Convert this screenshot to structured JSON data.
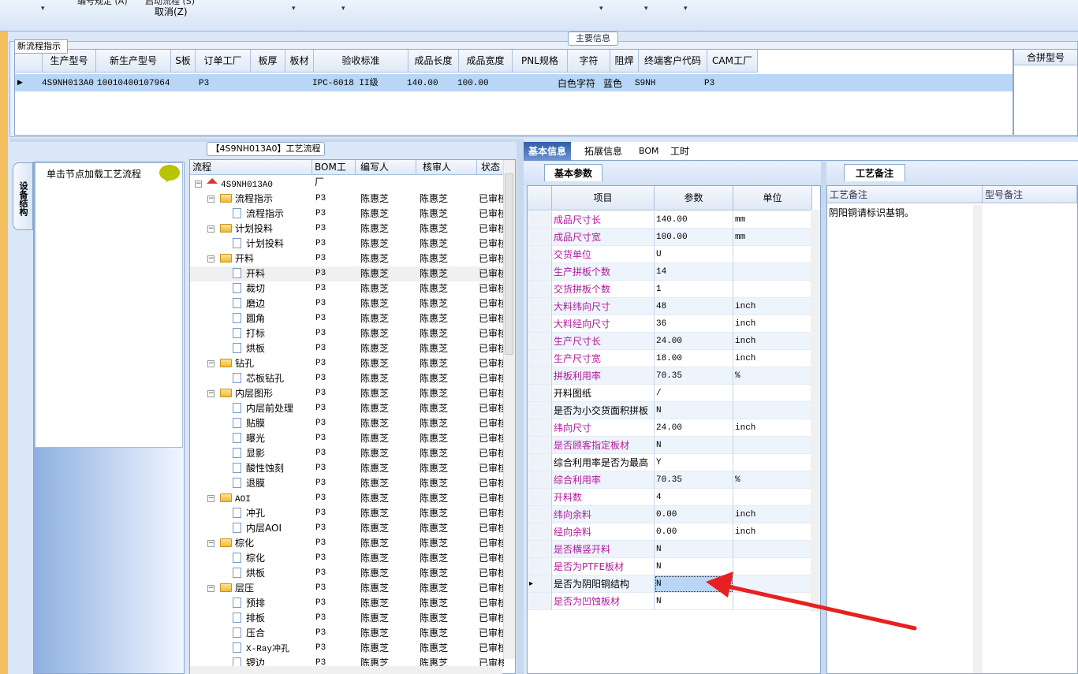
{
  "ribbon": {
    "cut_left": "编号规定 (A)",
    "cut_mid": "启动流程 (S)",
    "cancel": "取消(Z)",
    "dropdown_glyph": "▾"
  },
  "main": {
    "section_title": "主要信息",
    "flow_indicator_label": "新流程指示",
    "columns": [
      "生产型号",
      "新生产型号",
      "S板",
      "订单工厂",
      "板厚",
      "板材",
      "验收标准",
      "成品长度",
      "成品宽度",
      "PNL规格",
      "字符",
      "阻焊",
      "终端客户代码",
      "CAM工厂"
    ],
    "row": {
      "prod_model": "4S9NH013A0",
      "new_model": "10010400107964",
      "s_board": "",
      "order_factory": "P3",
      "thickness": "",
      "material": "",
      "standard": "IPC-6018 II级",
      "length": "140.00",
      "width": "100.00",
      "pnl": "",
      "char": "白色字符",
      "mask": "蓝色",
      "customer": "S9NH",
      "cam": "P3"
    },
    "merge_title": "合拼型号"
  },
  "process": {
    "title": "【4S9NH013A0】工艺流程",
    "vtab": "设备结构",
    "load_hint": "单击节点加载工艺流程",
    "columns": [
      "流程",
      "BOM工厂",
      "编写人",
      "核审人",
      "状态"
    ],
    "root": "4S9NH013A0",
    "nodes": [
      {
        "name": "流程指示",
        "type": "folder",
        "f": "P3",
        "w": "陈惠芝",
        "r": "陈惠芝",
        "s": "已审核"
      },
      {
        "name": "流程指示",
        "type": "doc",
        "f": "P3",
        "w": "陈惠芝",
        "r": "陈惠芝",
        "s": "已审核"
      },
      {
        "name": "计划投料",
        "type": "folder",
        "f": "P3",
        "w": "陈惠芝",
        "r": "陈惠芝",
        "s": "已审核"
      },
      {
        "name": "计划投料",
        "type": "doc",
        "f": "P3",
        "w": "陈惠芝",
        "r": "陈惠芝",
        "s": "已审核"
      },
      {
        "name": "开料",
        "type": "folder",
        "f": "P3",
        "w": "陈惠芝",
        "r": "陈惠芝",
        "s": "已审核"
      },
      {
        "name": "开料",
        "type": "doc",
        "f": "P3",
        "w": "陈惠芝",
        "r": "陈惠芝",
        "s": "已审核"
      },
      {
        "name": "裁切",
        "type": "doc",
        "f": "P3",
        "w": "陈惠芝",
        "r": "陈惠芝",
        "s": "已审核"
      },
      {
        "name": "磨边",
        "type": "doc",
        "f": "P3",
        "w": "陈惠芝",
        "r": "陈惠芝",
        "s": "已审核"
      },
      {
        "name": "圆角",
        "type": "doc",
        "f": "P3",
        "w": "陈惠芝",
        "r": "陈惠芝",
        "s": "已审核"
      },
      {
        "name": "打标",
        "type": "doc",
        "f": "P3",
        "w": "陈惠芝",
        "r": "陈惠芝",
        "s": "已审核"
      },
      {
        "name": "烘板",
        "type": "doc",
        "f": "P3",
        "w": "陈惠芝",
        "r": "陈惠芝",
        "s": "已审核"
      },
      {
        "name": "钻孔",
        "type": "folder",
        "f": "P3",
        "w": "陈惠芝",
        "r": "陈惠芝",
        "s": "已审核"
      },
      {
        "name": "芯板钻孔",
        "type": "doc",
        "f": "P3",
        "w": "陈惠芝",
        "r": "陈惠芝",
        "s": "已审核"
      },
      {
        "name": "内层图形",
        "type": "folder",
        "f": "P3",
        "w": "陈惠芝",
        "r": "陈惠芝",
        "s": "已审核"
      },
      {
        "name": "内层前处理",
        "type": "doc",
        "f": "P3",
        "w": "陈惠芝",
        "r": "陈惠芝",
        "s": "已审核"
      },
      {
        "name": "贴膜",
        "type": "doc",
        "f": "P3",
        "w": "陈惠芝",
        "r": "陈惠芝",
        "s": "已审核"
      },
      {
        "name": "曝光",
        "type": "doc",
        "f": "P3",
        "w": "陈惠芝",
        "r": "陈惠芝",
        "s": "已审核"
      },
      {
        "name": "显影",
        "type": "doc",
        "f": "P3",
        "w": "陈惠芝",
        "r": "陈惠芝",
        "s": "已审核"
      },
      {
        "name": "酸性蚀刻",
        "type": "doc",
        "f": "P3",
        "w": "陈惠芝",
        "r": "陈惠芝",
        "s": "已审核"
      },
      {
        "name": "退膜",
        "type": "doc",
        "f": "P3",
        "w": "陈惠芝",
        "r": "陈惠芝",
        "s": "已审核"
      },
      {
        "name": "AOI",
        "type": "folder",
        "f": "P3",
        "w": "陈惠芝",
        "r": "陈惠芝",
        "s": "已审核"
      },
      {
        "name": "冲孔",
        "type": "doc",
        "f": "P3",
        "w": "陈惠芝",
        "r": "陈惠芝",
        "s": "已审核"
      },
      {
        "name": "内层AOI",
        "type": "doc",
        "f": "P3",
        "w": "陈惠芝",
        "r": "陈惠芝",
        "s": "已审核"
      },
      {
        "name": "棕化",
        "type": "folder",
        "f": "P3",
        "w": "陈惠芝",
        "r": "陈惠芝",
        "s": "已审核"
      },
      {
        "name": "棕化",
        "type": "doc",
        "f": "P3",
        "w": "陈惠芝",
        "r": "陈惠芝",
        "s": "已审核"
      },
      {
        "name": "烘板",
        "type": "doc",
        "f": "P3",
        "w": "陈惠芝",
        "r": "陈惠芝",
        "s": "已审核"
      },
      {
        "name": "层压",
        "type": "folder",
        "f": "P3",
        "w": "陈惠芝",
        "r": "陈惠芝",
        "s": "已审核"
      },
      {
        "name": "预排",
        "type": "doc",
        "f": "P3",
        "w": "陈惠芝",
        "r": "陈惠芝",
        "s": "已审核"
      },
      {
        "name": "排板",
        "type": "doc",
        "f": "P3",
        "w": "陈惠芝",
        "r": "陈惠芝",
        "s": "已审核"
      },
      {
        "name": "压合",
        "type": "doc",
        "f": "P3",
        "w": "陈惠芝",
        "r": "陈惠芝",
        "s": "已审核"
      },
      {
        "name": "X-Ray冲孔",
        "type": "doc",
        "f": "P3",
        "w": "陈惠芝",
        "r": "陈惠芝",
        "s": "已审核"
      },
      {
        "name": "锣边",
        "type": "doc",
        "f": "P3",
        "w": "陈惠芝",
        "r": "陈惠芝",
        "s": "已审核"
      }
    ]
  },
  "tabs": [
    "基本信息",
    "拓展信息",
    "BOM",
    "工时"
  ],
  "params": {
    "title": "基本参数",
    "columns": [
      "项目",
      "参数",
      "单位"
    ],
    "rows": [
      {
        "k": "成品尺寸长",
        "v": "140.00",
        "u": "mm",
        "pink": true
      },
      {
        "k": "成品尺寸宽",
        "v": "100.00",
        "u": "mm",
        "pink": true
      },
      {
        "k": "交货单位",
        "v": "U",
        "u": "",
        "pink": true
      },
      {
        "k": "生产拼板个数",
        "v": "14",
        "u": "",
        "pink": true
      },
      {
        "k": "交货拼板个数",
        "v": "1",
        "u": "",
        "pink": true
      },
      {
        "k": "大料纬向尺寸",
        "v": "48",
        "u": "inch",
        "pink": true
      },
      {
        "k": "大料经向尺寸",
        "v": "36",
        "u": "inch",
        "pink": true
      },
      {
        "k": "生产尺寸长",
        "v": "24.00",
        "u": "inch",
        "pink": true
      },
      {
        "k": "生产尺寸宽",
        "v": "18.00",
        "u": "inch",
        "pink": true
      },
      {
        "k": "拼板利用率",
        "v": "70.35",
        "u": "%",
        "pink": true
      },
      {
        "k": "开料图纸",
        "v": "/",
        "u": "",
        "pink": false
      },
      {
        "k": "是否为小交货面积拼板",
        "v": "N",
        "u": "",
        "pink": false
      },
      {
        "k": "纬向尺寸",
        "v": "24.00",
        "u": "inch",
        "pink": true
      },
      {
        "k": "是否顾客指定板材",
        "v": "N",
        "u": "",
        "pink": true
      },
      {
        "k": "综合利用率是否为最高",
        "v": "Y",
        "u": "",
        "pink": false
      },
      {
        "k": "综合利用率",
        "v": "70.35",
        "u": "%",
        "pink": true
      },
      {
        "k": "开料数",
        "v": "4",
        "u": "",
        "pink": true
      },
      {
        "k": "纬向余料",
        "v": "0.00",
        "u": "inch",
        "pink": true
      },
      {
        "k": "经向余料",
        "v": "0.00",
        "u": "inch",
        "pink": true
      },
      {
        "k": "是否横竖开料",
        "v": "N",
        "u": "",
        "pink": true
      },
      {
        "k": "是否为PTFE板材",
        "v": "N",
        "u": "",
        "pink": true
      },
      {
        "k": "是否为阴阳铜结构",
        "v": "N",
        "u": "",
        "pink": false,
        "current": true
      },
      {
        "k": "是否为凹蚀板材",
        "v": "N",
        "u": "",
        "pink": true
      }
    ]
  },
  "notes": {
    "title": "工艺备注",
    "col1": "工艺备注",
    "col2": "型号备注",
    "text": "阴阳铜请标识基铜。"
  },
  "annotation": {
    "arrow_color": "#e82020"
  }
}
